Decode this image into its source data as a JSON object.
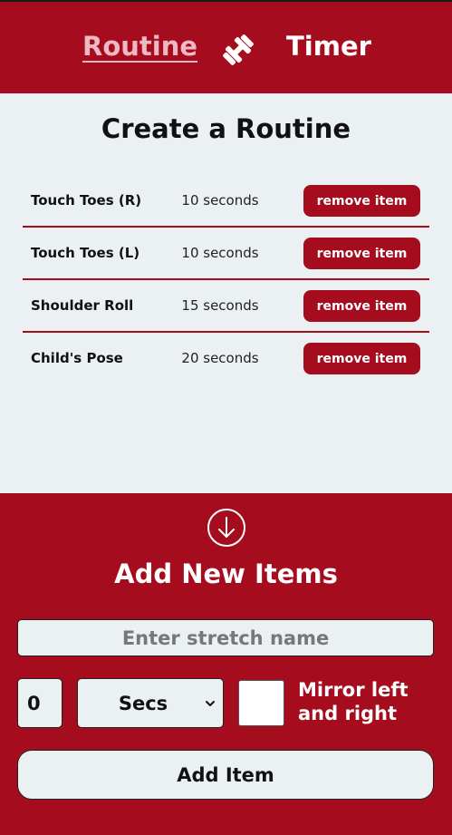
{
  "header": {
    "nav_routine": "Routine",
    "nav_timer": "Timer",
    "icon": "dumbbell-icon"
  },
  "routine": {
    "title": "Create a Routine",
    "items": [
      {
        "name": "Touch Toes (R)",
        "duration": "10 seconds",
        "action": "remove item"
      },
      {
        "name": "Touch Toes (L)",
        "duration": "10 seconds",
        "action": "remove item"
      },
      {
        "name": "Shoulder Roll",
        "duration": "15 seconds",
        "action": "remove item"
      },
      {
        "name": "Child's Pose",
        "duration": "20 seconds",
        "action": "remove item"
      }
    ]
  },
  "add": {
    "icon": "arrow-down-circle-icon",
    "title": "Add New Items",
    "name_placeholder": "Enter stretch name",
    "amount_value": "0",
    "unit_selected": "Secs",
    "mirror_label": "Mirror left and right",
    "add_button": "Add Item"
  },
  "colors": {
    "brand": "#a50d1f",
    "panel": "#ebf0f3",
    "active_nav": "#f0b8c4"
  }
}
